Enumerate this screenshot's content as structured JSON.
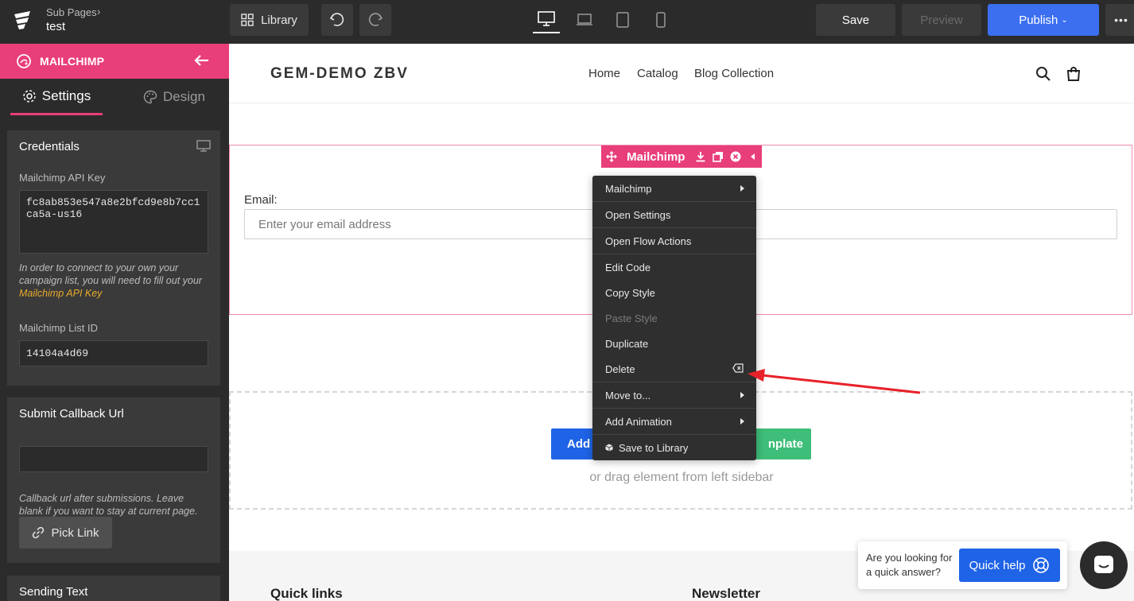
{
  "topbar": {
    "breadcrumb_parent": "Sub Pages",
    "page_title": "test",
    "library_label": "Library",
    "save_label": "Save",
    "preview_label": "Preview",
    "publish_label": "Publish",
    "active_device": "desktop"
  },
  "sidebar": {
    "header_title": "MAILCHIMP",
    "tabs": [
      {
        "label": "Settings",
        "active": true
      },
      {
        "label": "Design",
        "active": false
      }
    ],
    "credentials": {
      "title": "Credentials",
      "api_key_label": "Mailchimp API Key",
      "api_key_value": "fc8ab853e547a8e2bfcd9e8b7cc1ca5a-us16",
      "help_prefix": "In order to connect to your own your campaign list, you will need to fill out your ",
      "help_link": "Mailchimp API Key",
      "list_id_label": "Mailchimp List ID",
      "list_id_value": "14104a4d69"
    },
    "callback": {
      "title": "Submit Callback Url",
      "value": "",
      "help": "Callback url after submissions. Leave blank if you want to stay at current page.",
      "pick_link_label": "Pick Link"
    },
    "sending_text_title": "Sending Text"
  },
  "canvas": {
    "store_title": "GEM-DEMO ZBV",
    "nav": [
      "Home",
      "Catalog",
      "Blog Collection"
    ],
    "element_toolbar_label": "Mailchimp",
    "email_label": "Email:",
    "email_placeholder": "Enter your email address",
    "add_button_label": "Add N",
    "template_button_label": "nplate",
    "drag_hint": "or drag element from left sidebar",
    "footer_left": "Quick links",
    "footer_right": "Newsletter"
  },
  "context_menu": {
    "items": [
      {
        "label": "Mailchimp",
        "submenu": true,
        "disabled": false
      },
      {
        "label": "Open Settings",
        "submenu": false,
        "disabled": false
      },
      {
        "label": "Open Flow Actions",
        "submenu": false,
        "disabled": false
      },
      {
        "label": "Edit Code",
        "submenu": false,
        "disabled": false
      },
      {
        "label": "Copy Style",
        "submenu": false,
        "disabled": false
      },
      {
        "label": "Paste Style",
        "submenu": false,
        "disabled": true
      },
      {
        "label": "Duplicate",
        "submenu": false,
        "disabled": false
      },
      {
        "label": "Delete",
        "submenu": false,
        "disabled": false,
        "shortcut_icon": "backspace-icon"
      },
      {
        "label": "Move to...",
        "submenu": true,
        "disabled": false
      },
      {
        "label": "Add Animation",
        "submenu": true,
        "disabled": false
      },
      {
        "label": "Save to Library",
        "submenu": false,
        "disabled": false,
        "icon": "cube-icon"
      }
    ]
  },
  "quick_help": {
    "prompt": "Are you looking for a quick answer?",
    "button_label": "Quick help"
  },
  "colors": {
    "accent_pink": "#e83e7a",
    "publish_blue": "#3b6ff0",
    "button_blue": "#1f63e6",
    "template_green": "#3ebe78",
    "link_orange": "#e8a92e",
    "annotation_red": "#e8222a"
  }
}
